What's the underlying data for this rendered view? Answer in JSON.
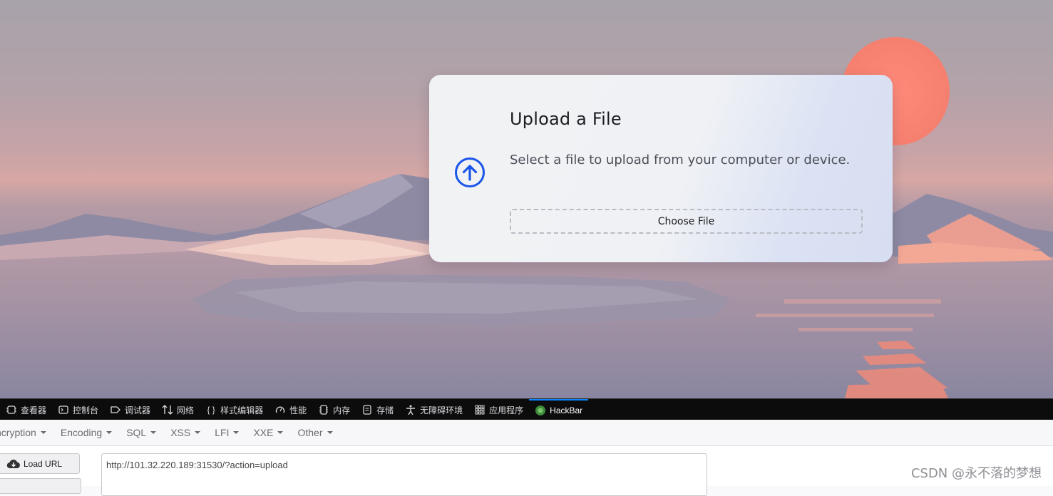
{
  "card": {
    "title": "Upload a File",
    "description": "Select a file to upload from your computer or device.",
    "choose_file_label": "Choose File",
    "icon": "arrow-up-circle-icon",
    "accent": "#1a56e8"
  },
  "devtools": {
    "tabs": [
      {
        "label": "查看器",
        "icon": "inspector-icon"
      },
      {
        "label": "控制台",
        "icon": "console-icon"
      },
      {
        "label": "调试器",
        "icon": "debugger-icon"
      },
      {
        "label": "网络",
        "icon": "network-icon"
      },
      {
        "label": "样式编辑器",
        "icon": "style-editor-icon"
      },
      {
        "label": "性能",
        "icon": "performance-icon"
      },
      {
        "label": "内存",
        "icon": "memory-icon"
      },
      {
        "label": "存储",
        "icon": "storage-icon"
      },
      {
        "label": "无障碍环境",
        "icon": "accessibility-icon"
      },
      {
        "label": "应用程序",
        "icon": "application-icon"
      },
      {
        "label": "HackBar",
        "icon": "hackbar-icon",
        "active": true
      }
    ]
  },
  "hackbar": {
    "menu": [
      "ncryption",
      "Encoding",
      "SQL",
      "XSS",
      "LFI",
      "XXE",
      "Other"
    ],
    "load_url_label": "Load URL",
    "url_value": "http://101.32.220.189:31530/?action=upload"
  },
  "watermark": "CSDN @永不落的梦想"
}
